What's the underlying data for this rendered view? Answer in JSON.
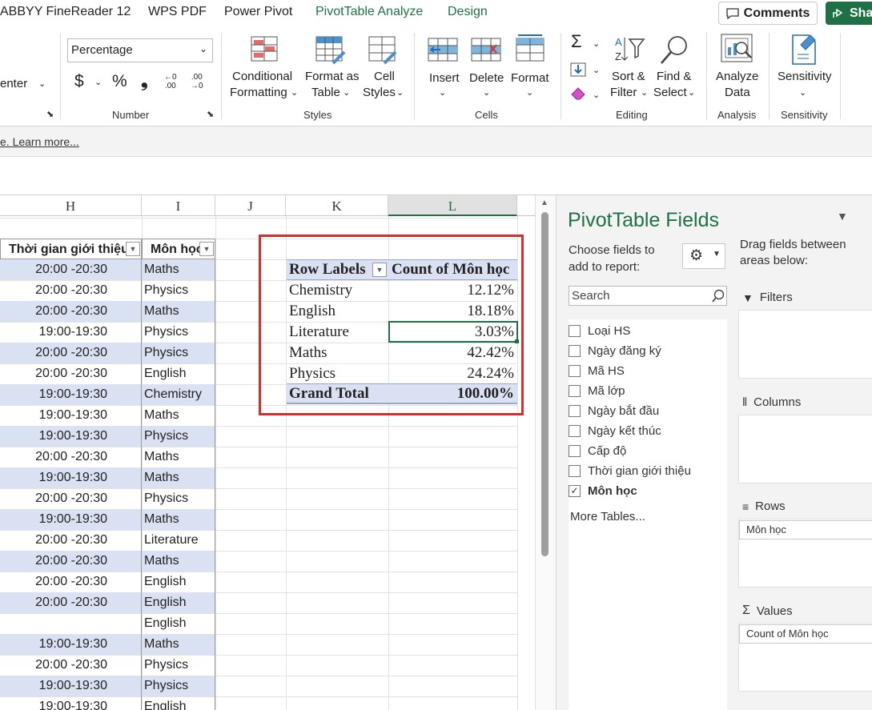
{
  "tabs": [
    "ABBYY FineReader 12",
    "WPS PDF",
    "Power Pivot",
    "PivotTable Analyze",
    "Design"
  ],
  "header_buttons": {
    "comments": "Comments",
    "share": "Sha"
  },
  "ribbon": {
    "alignment_partial": "enter",
    "number_format": "Percentage",
    "number_buttons": {
      "currency": "$",
      "percent": "%",
      "comma": "❟"
    },
    "groups": {
      "number": "Number",
      "styles": "Styles",
      "cells": "Cells",
      "editing": "Editing",
      "analysis": "Analysis",
      "sensitivity": "Sensitivity"
    },
    "styles": {
      "cond1": "Conditional",
      "cond2": "Formatting",
      "fmt1": "Format as",
      "fmt2": "Table",
      "cell1": "Cell",
      "cell2": "Styles"
    },
    "cells": {
      "insert": "Insert",
      "delete": "Delete",
      "format": "Format"
    },
    "editing": {
      "sort1": "Sort &",
      "sort2": "Filter",
      "find1": "Find &",
      "find2": "Select"
    },
    "analysis": {
      "a1": "Analyze",
      "a2": "Data"
    },
    "sens": {
      "s1": "Sensitivity"
    }
  },
  "message_bar": {
    "link": "e. Learn more..."
  },
  "columns": [
    "H",
    "I",
    "J",
    "K",
    "L"
  ],
  "table": {
    "header_h": "Thời gian giới thiệu",
    "header_i": "Môn học",
    "rows": [
      [
        "20:00 -20:30",
        "Maths"
      ],
      [
        "20:00 -20:30",
        "Physics"
      ],
      [
        "20:00 -20:30",
        "Maths"
      ],
      [
        "19:00-19:30",
        "Physics"
      ],
      [
        "20:00 -20:30",
        "Physics"
      ],
      [
        "20:00 -20:30",
        "English"
      ],
      [
        "19:00-19:30",
        "Chemistry"
      ],
      [
        "19:00-19:30",
        "Maths"
      ],
      [
        "19:00-19:30",
        "Physics"
      ],
      [
        "20:00 -20:30",
        "Maths"
      ],
      [
        "19:00-19:30",
        "Maths"
      ],
      [
        "20:00 -20:30",
        "Physics"
      ],
      [
        "19:00-19:30",
        "Maths"
      ],
      [
        "20:00 -20:30",
        "Literature"
      ],
      [
        "20:00 -20:30",
        "Maths"
      ],
      [
        "20:00 -20:30",
        "English"
      ],
      [
        "20:00 -20:30",
        "English"
      ],
      [
        "",
        "English"
      ],
      [
        "19:00-19:30",
        "Maths"
      ],
      [
        "20:00 -20:30",
        "Physics"
      ],
      [
        "19:00-19:30",
        "Physics"
      ],
      [
        "19:00-19:30",
        "English"
      ]
    ]
  },
  "pivot": {
    "col1": "Row Labels",
    "col2": "Count of Môn học",
    "rows": [
      [
        "Chemistry",
        "12.12%"
      ],
      [
        "English",
        "18.18%"
      ],
      [
        "Literature",
        "3.03%"
      ],
      [
        "Maths",
        "42.42%"
      ],
      [
        "Physics",
        "24.24%"
      ]
    ],
    "total_label": "Grand Total",
    "total_value": "100.00%"
  },
  "pane": {
    "title": "PivotTable Fields",
    "choose": "Choose fields to add to report:",
    "drag": "Drag fields between areas below:",
    "search_placeholder": "Search",
    "fields": [
      {
        "name": "Loại HS",
        "checked": false
      },
      {
        "name": "Ngày đăng ký",
        "checked": false
      },
      {
        "name": "Mã HS",
        "checked": false
      },
      {
        "name": "Mã lớp",
        "checked": false
      },
      {
        "name": "Ngày bắt đầu",
        "checked": false
      },
      {
        "name": "Ngày kết thúc",
        "checked": false
      },
      {
        "name": "Cấp độ",
        "checked": false
      },
      {
        "name": "Thời gian giới thiệu",
        "checked": false
      },
      {
        "name": "Môn học",
        "checked": true
      }
    ],
    "more": "More Tables...",
    "areas": {
      "filters": "Filters",
      "columns": "Columns",
      "rows": "Rows",
      "values": "Values"
    },
    "rows_chip": "Môn học",
    "values_chip": "Count of Môn học"
  }
}
